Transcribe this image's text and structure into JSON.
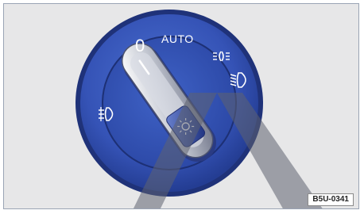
{
  "dial": {
    "off_label": "0",
    "auto_label": "AUTO",
    "icons": {
      "parking_lights": "parking-lights-icon",
      "low_beam": "low-beam-icon",
      "fog_light": "fog-light-icon",
      "interior_light": "interior-light-icon"
    }
  },
  "figure_id": "B5U-0341",
  "colors": {
    "background": "#e7e7e8",
    "dial_blue": "#2f4fb2",
    "dial_rim": "#22357a",
    "knob_silver": "#c9ccd6",
    "marker_line": "#ffffff"
  }
}
